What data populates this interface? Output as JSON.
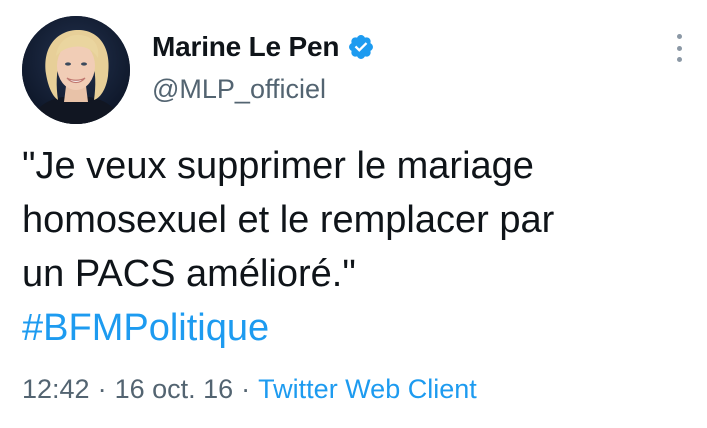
{
  "author": {
    "display_name": "Marine Le Pen",
    "handle": "@MLP_officiel",
    "verified": true,
    "verified_color": "#1d9bf0"
  },
  "tweet": {
    "lines": [
      "\"Je veux supprimer le mariage",
      "homosexuel et le remplacer par",
      "un PACS amélioré.\""
    ],
    "hashtag": "#BFMPolitique"
  },
  "meta": {
    "time": "12:42",
    "separator": "·",
    "date": "16 oct. 16",
    "source": "Twitter Web Client"
  },
  "colors": {
    "text": "#0f1419",
    "secondary": "#536471",
    "link": "#1d9bf0"
  },
  "icons": {
    "verified": "verified-badge-icon",
    "more": "more-options-icon"
  }
}
